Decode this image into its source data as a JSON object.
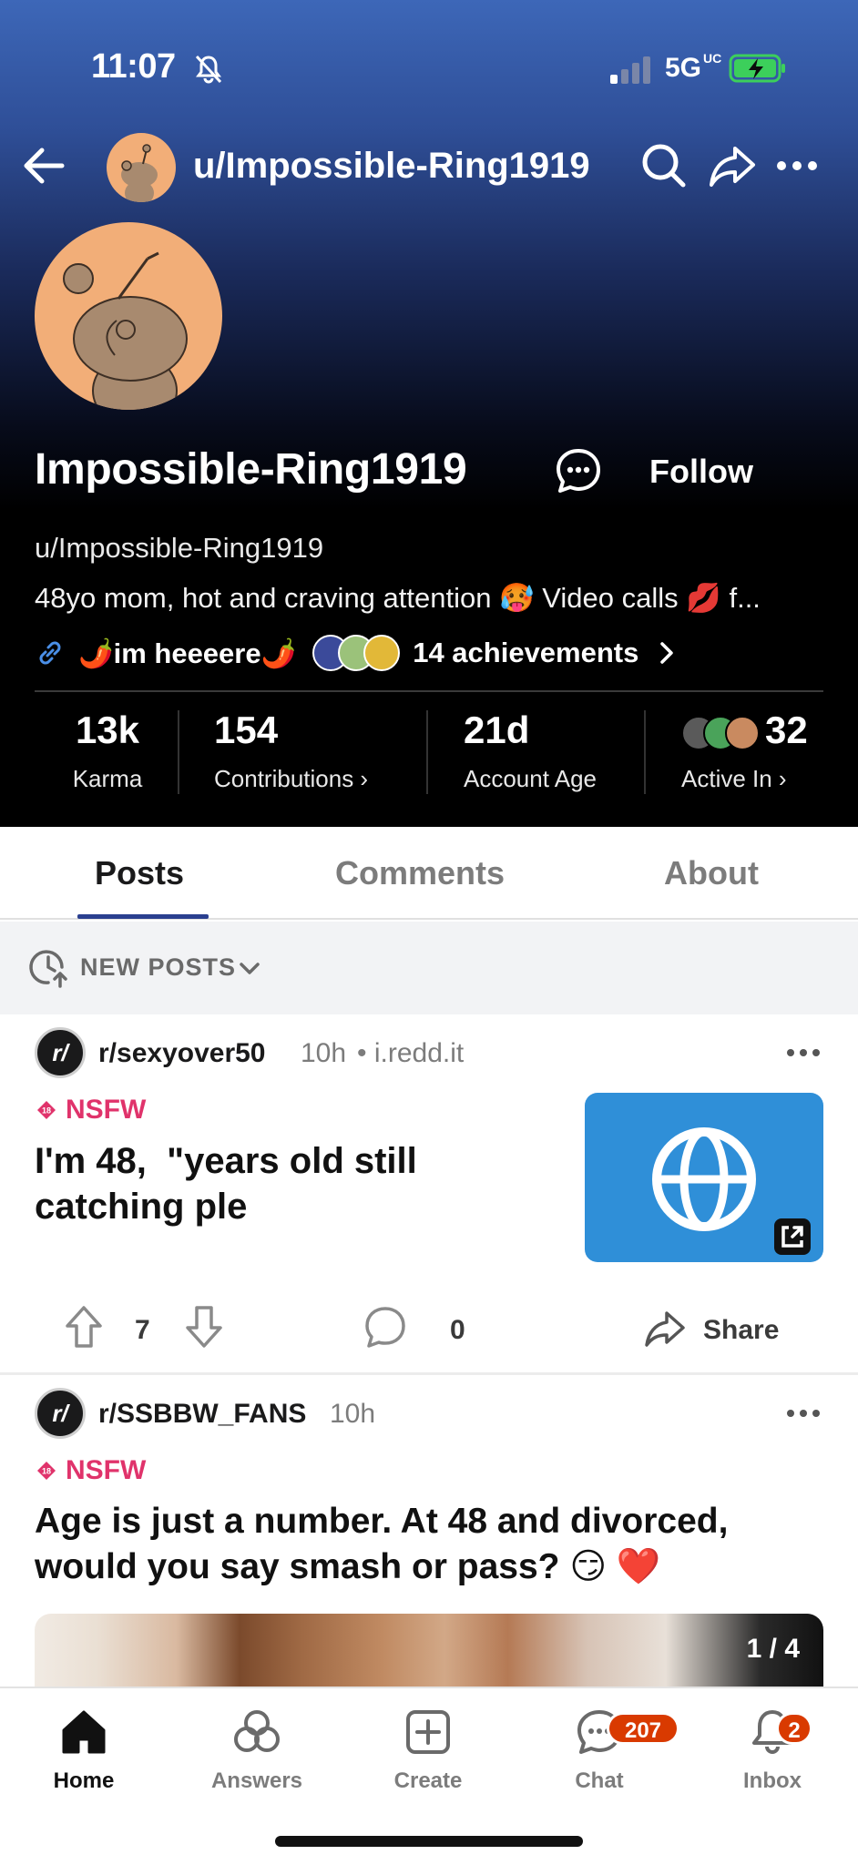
{
  "status_bar": {
    "time": "11:07",
    "network": "5G",
    "network_suffix": "UC"
  },
  "top_nav": {
    "username": "u/Impossible-Ring1919"
  },
  "profile": {
    "display_name": "Impossible-Ring1919",
    "follow_label": "Follow",
    "username": "u/Impossible-Ring1919",
    "bio": "48yo mom, hot and craving attention 🥵 Video calls 💋 f...",
    "link_text": "🌶️im heeeere🌶️",
    "achievements_label": "14 achievements",
    "stats": {
      "karma_value": "13k",
      "karma_label": "Karma",
      "contributions_value": "154",
      "contributions_label": "Contributions ›",
      "age_value": "21d",
      "age_label": "Account Age",
      "active_value": "32",
      "active_label": "Active In ›"
    }
  },
  "tabs": [
    {
      "label": "Posts"
    },
    {
      "label": "Comments"
    },
    {
      "label": "About"
    }
  ],
  "sort": {
    "label": "NEW POSTS"
  },
  "posts": [
    {
      "subreddit": "r/sexyover50",
      "time": "10h",
      "domain": "• i.redd.it",
      "nsfw_label": "NSFW",
      "title_line1": "I'm 48,  \"years old still",
      "title_line2": "catching ple",
      "upvotes": "7",
      "comments": "0",
      "share_label": "Share"
    },
    {
      "subreddit": "r/SSBBW_FANS",
      "time": "10h",
      "nsfw_label": "NSFW",
      "title_line1": "Age is just a number. At 48 and divorced,",
      "title_line2": "would you say smash or pass? 😏 ❤️",
      "image_counter": "1 / 4"
    }
  ],
  "bottom_nav": {
    "items": [
      {
        "label": "Home"
      },
      {
        "label": "Answers"
      },
      {
        "label": "Create"
      },
      {
        "label": "Chat",
        "badge": "207"
      },
      {
        "label": "Inbox",
        "badge": "2"
      }
    ]
  },
  "colors": {
    "accent": "#2a3f8f",
    "nsfw": "#e0336b",
    "badge": "#d93a00",
    "avatar": "#f2ae78"
  }
}
